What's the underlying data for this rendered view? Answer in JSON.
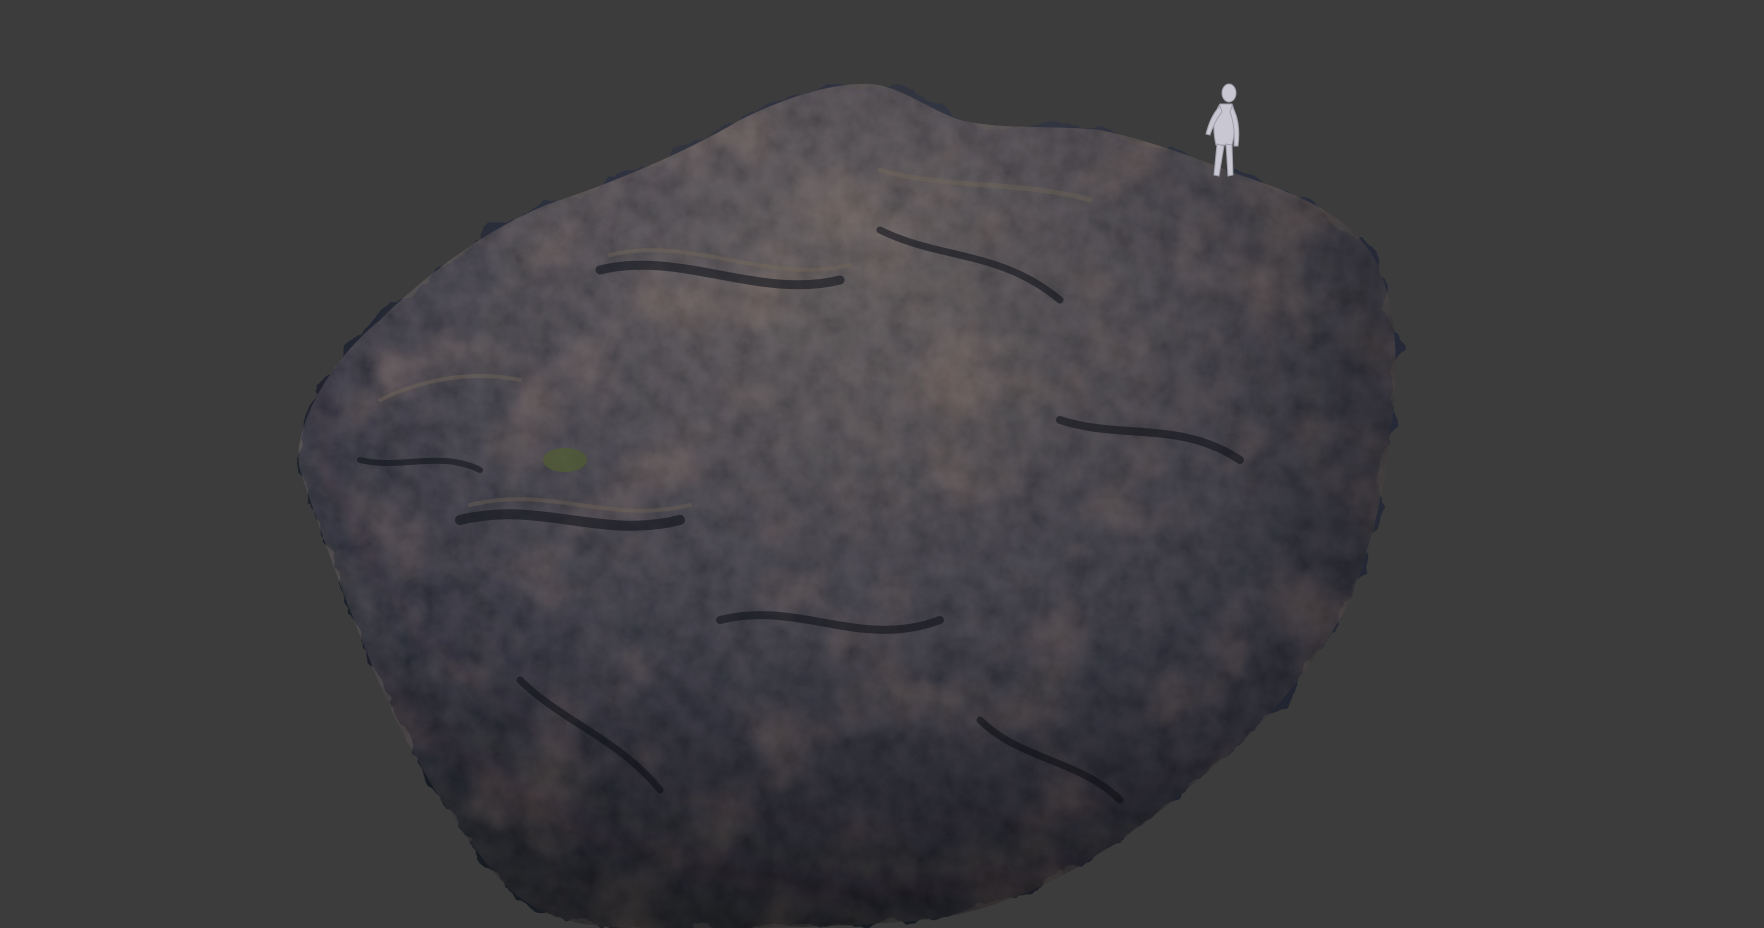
{
  "viewport": {
    "background_color": "#3c3c3c"
  },
  "scene": {
    "objects": [
      {
        "name": "rock-boulder",
        "colors": [
          "#2d3140",
          "#4a4a4f",
          "#6b5a48",
          "#1c1f29",
          "#5a4333"
        ]
      },
      {
        "name": "human-scale-mannequin",
        "color": "#c9c8d2"
      }
    ]
  }
}
